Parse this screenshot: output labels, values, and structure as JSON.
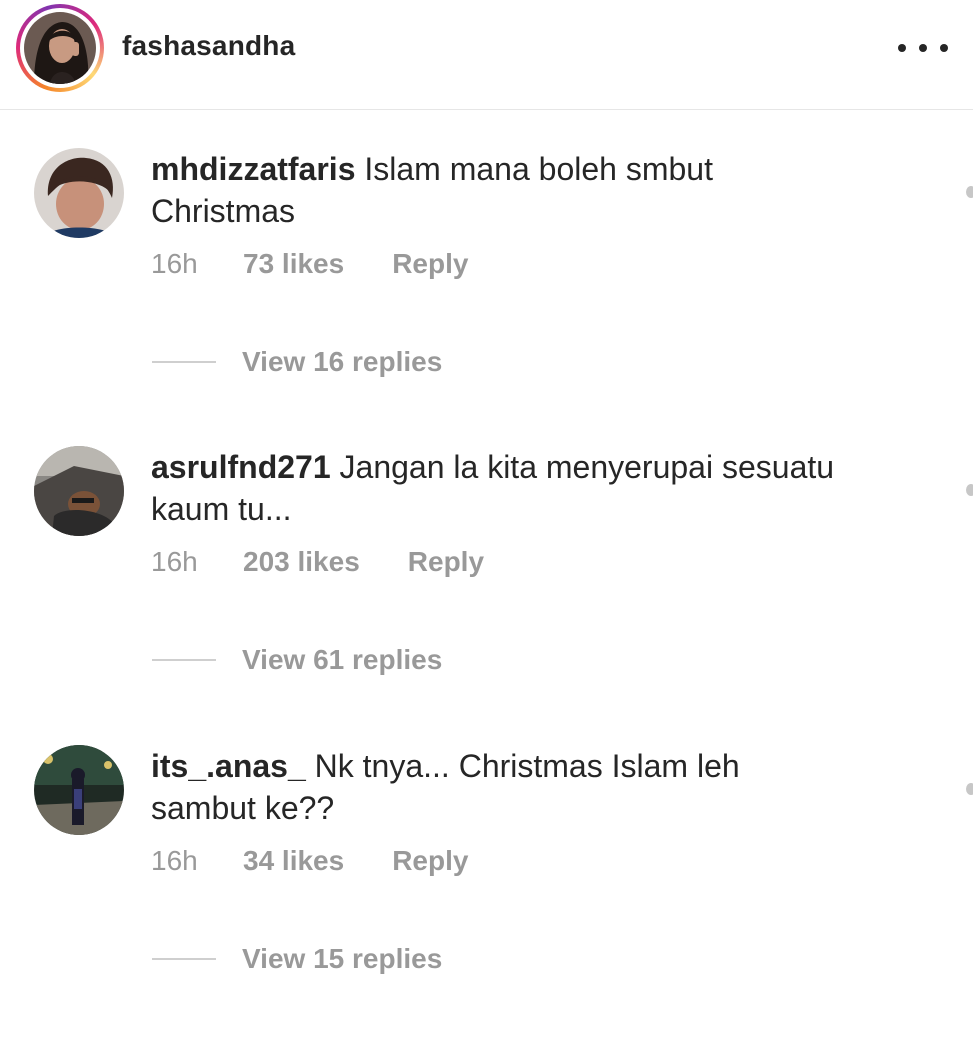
{
  "header": {
    "username": "fashasandha",
    "more_icon": "more-horizontal-icon"
  },
  "comments": [
    {
      "username": "mhdizzatfaris",
      "text": " Islam mana boleh smbut Christmas",
      "time": "16h",
      "likes": "73 likes",
      "reply": "Reply",
      "view_replies": "View 16 replies"
    },
    {
      "username": "asrulfnd271",
      "text": " Jangan la kita menyerupai sesuatu kaum tu...",
      "time": "16h",
      "likes": "203 likes",
      "reply": "Reply",
      "view_replies": "View 61 replies"
    },
    {
      "username": "its_.anas_",
      "text": " Nk tnya... Christmas Islam leh sambut ke??",
      "time": "16h",
      "likes": "34 likes",
      "reply": "Reply",
      "view_replies": "View 15 replies"
    }
  ],
  "colors": {
    "text": "#262626",
    "meta": "#999999",
    "divider": "#e6e6e6",
    "story_ring": "#dd2a7b"
  }
}
